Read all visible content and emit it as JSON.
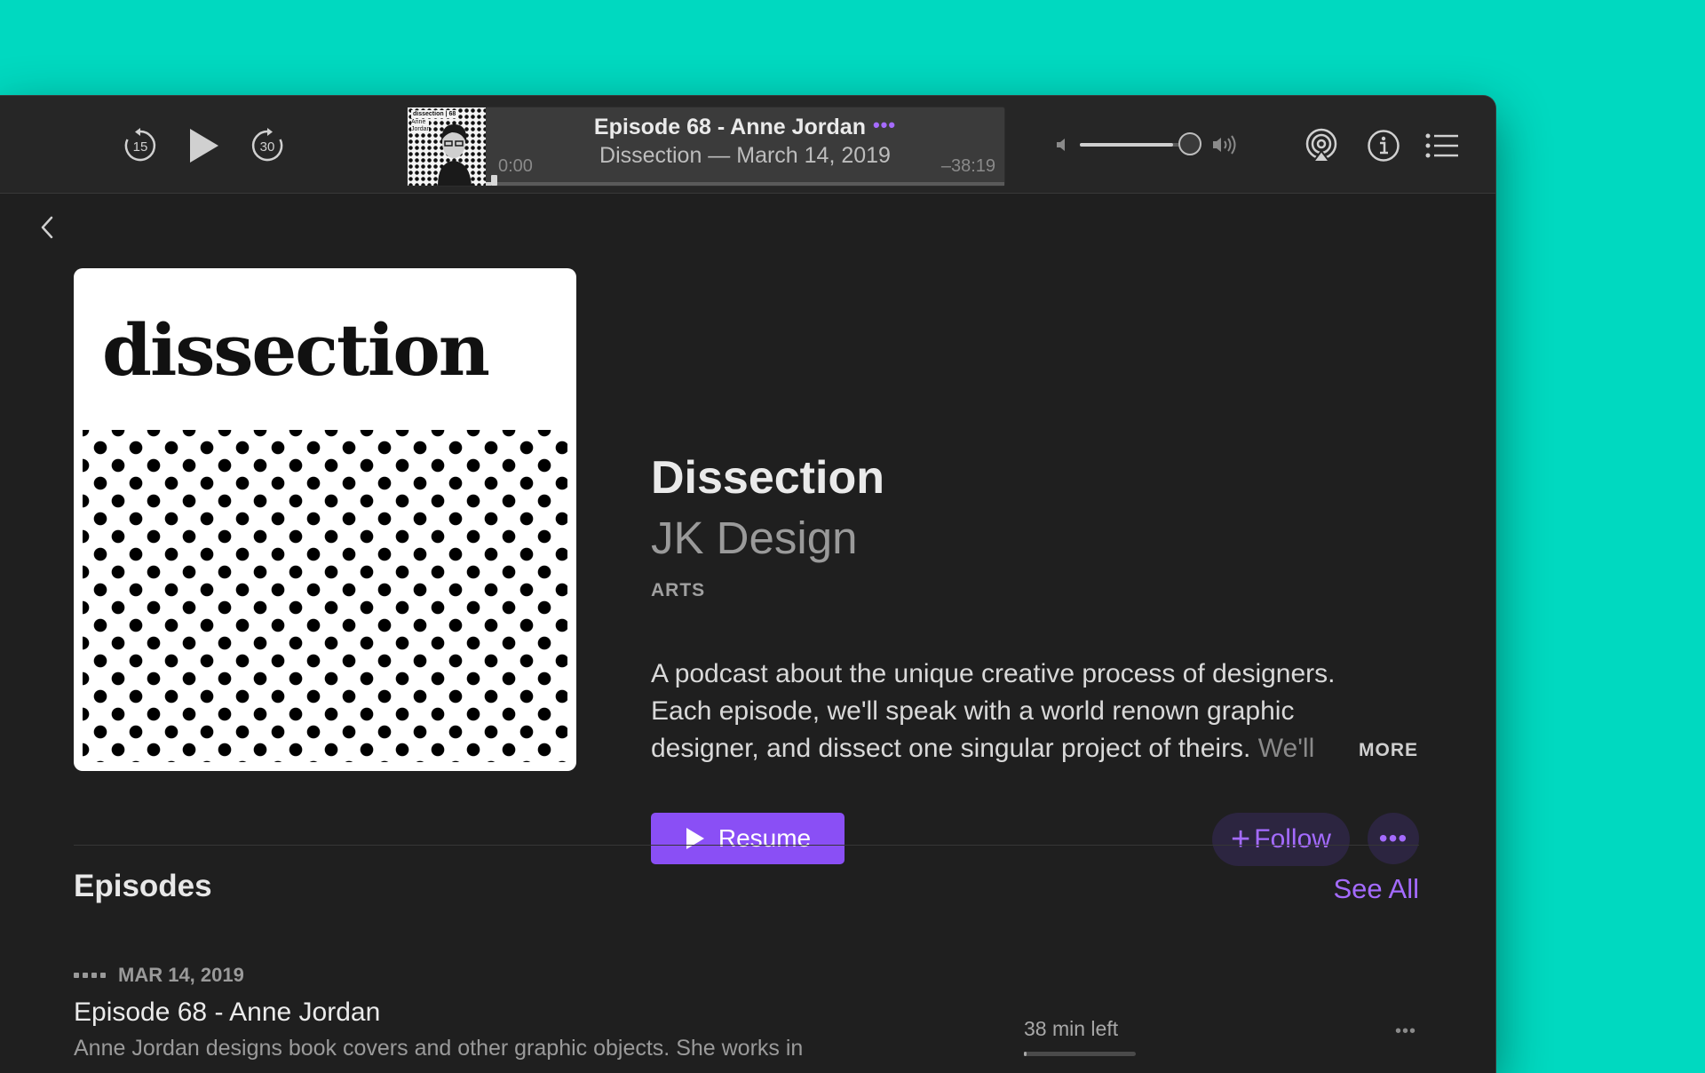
{
  "colors": {
    "desktop_background": "#00d9c0",
    "window_background": "#1f1f1f",
    "toolbar_background": "#262626",
    "accent": "#8a4ff5",
    "accent_text": "#a46bff"
  },
  "toolbar": {
    "skip_back": {
      "label": "15",
      "icon": "skip-back-15-icon"
    },
    "play": {
      "icon": "play-icon"
    },
    "skip_forward": {
      "label": "30",
      "icon": "skip-forward-30-icon"
    },
    "now_playing": {
      "title": "Episode 68 - Anne Jordan",
      "subtitle": "Dissection — March 14, 2019",
      "elapsed": "0:00",
      "remaining": "–38:19",
      "more_icon": "•••",
      "progress": 0.01,
      "artwork": {
        "mini_title": "dissection | 68",
        "mini_name": "Anne Jordan"
      }
    },
    "volume": {
      "level": 0.85,
      "low_icon": "speaker-low-icon",
      "high_icon": "speaker-high-icon"
    },
    "airplay_icon": "airplay-icon",
    "info_icon": "info-icon",
    "queue_icon": "list-icon"
  },
  "podcast": {
    "artwork_word": "dissection",
    "title": "Dissection",
    "author": "JK Design",
    "category": "ARTS",
    "description_lines": [
      "A podcast about the unique creative process of designers.",
      "Each episode, we'll speak with a world renown graphic",
      "designer, and dissect one singular project of theirs."
    ],
    "description_fade": "We'll",
    "more_label": "MORE",
    "resume_label": "Resume",
    "follow_label": "Follow",
    "follow_plus": "+",
    "more_button": "•••"
  },
  "episodes": {
    "heading": "Episodes",
    "see_all": "See All",
    "items": [
      {
        "date": "MAR 14, 2019",
        "title": "Episode 68 - Anne Jordan",
        "description": "Anne Jordan designs book covers and other graphic objects. She works in",
        "time_left": "38 min left",
        "progress": 0.02,
        "more": "•••"
      }
    ]
  }
}
